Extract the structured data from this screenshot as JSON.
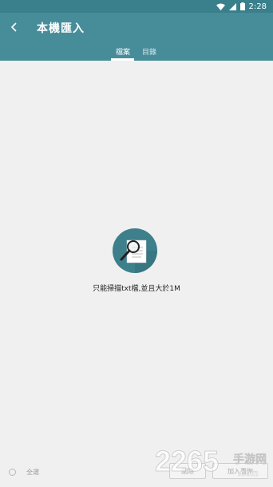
{
  "status_bar": {
    "time": "2:28"
  },
  "app_bar": {
    "title": "本機匯入",
    "tabs": [
      {
        "label": "檔案",
        "active": true
      },
      {
        "label": "目錄",
        "active": false
      }
    ]
  },
  "empty_state": {
    "message": "只能掃描txt檔,並且大於1M",
    "icon": "document-search-icon"
  },
  "bottom_bar": {
    "select_all_label": "全選",
    "delete_label": "刪除",
    "add_to_shelf_label": "加入書架"
  },
  "watermark": {
    "number": "2265",
    "text": "手游网",
    "domain": ".com"
  },
  "colors": {
    "app_bar": "#478d99",
    "status_bar": "#3a7f8c",
    "icon_circle": "#3e7f8c",
    "background": "#f0f0f0"
  }
}
